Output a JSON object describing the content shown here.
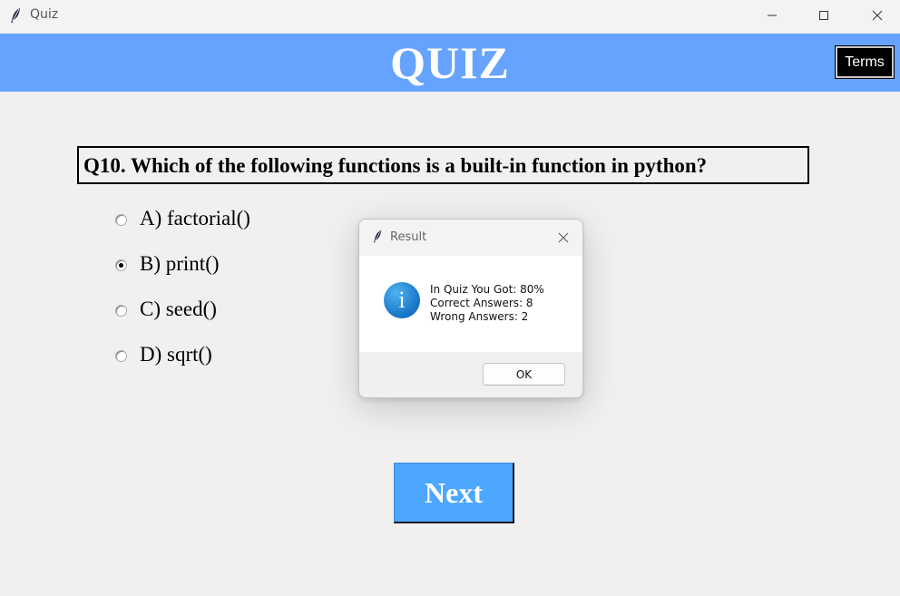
{
  "window": {
    "title": "Quiz",
    "icon": "feather-icon",
    "controls": [
      "minimize-icon",
      "maximize-icon",
      "close-icon"
    ]
  },
  "header": {
    "title": "QUIZ",
    "terms_label": "Terms",
    "bg_color": "#66a3ff"
  },
  "question": {
    "text": "Q10. Which of the following functions is a built-in function in python?"
  },
  "options": [
    {
      "label": "A) factorial()",
      "selected": false
    },
    {
      "label": "B) print()",
      "selected": true
    },
    {
      "label": "C) seed()",
      "selected": false
    },
    {
      "label": "D) sqrt()",
      "selected": false
    }
  ],
  "next_label": "Next",
  "dialog": {
    "title": "Result",
    "icon": "info-icon",
    "lines": [
      "In Quiz You Got: 80%",
      "Correct Answers: 8",
      "Wrong Answers: 2"
    ],
    "ok_label": "OK"
  }
}
